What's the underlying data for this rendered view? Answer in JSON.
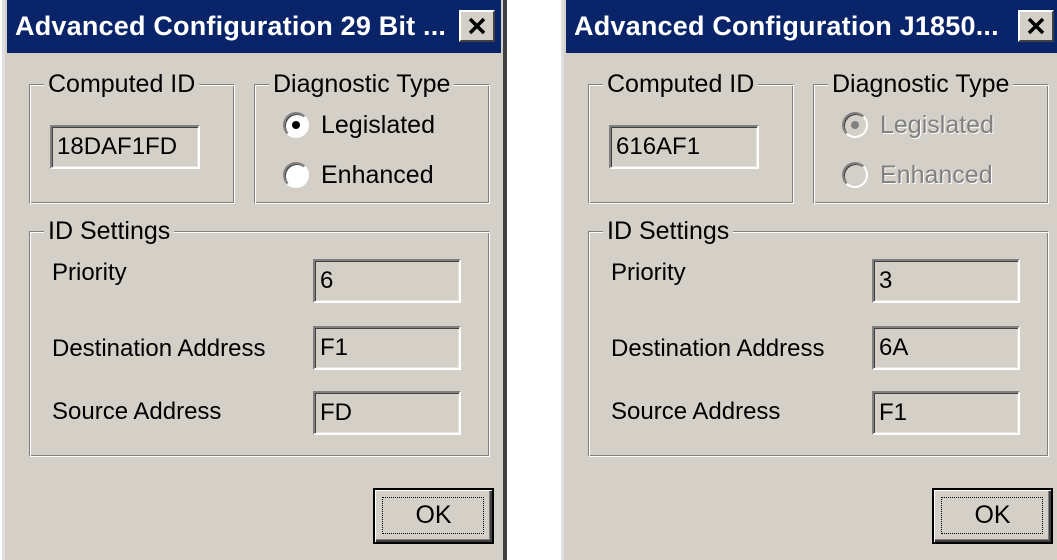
{
  "dialogs": [
    {
      "title": "Advanced Configuration 29 Bit ...",
      "computed_id_label": "Computed ID",
      "computed_id": "18DAF1FD",
      "diagnostic_type_label": "Diagnostic Type",
      "diagnostic_options": [
        {
          "label": "Legislated",
          "selected": true
        },
        {
          "label": "Enhanced",
          "selected": false
        }
      ],
      "diagnostic_enabled": true,
      "id_settings_label": "ID Settings",
      "priority_label": "Priority",
      "priority": "6",
      "destination_label": "Destination Address",
      "destination": "F1",
      "source_label": "Source Address",
      "source": "FD",
      "ok_label": "OK"
    },
    {
      "title": "Advanced Configuration J1850...",
      "computed_id_label": "Computed ID",
      "computed_id": "616AF1",
      "diagnostic_type_label": "Diagnostic Type",
      "diagnostic_options": [
        {
          "label": "Legislated",
          "selected": true
        },
        {
          "label": "Enhanced",
          "selected": false
        }
      ],
      "diagnostic_enabled": false,
      "id_settings_label": "ID Settings",
      "priority_label": "Priority",
      "priority": "3",
      "destination_label": "Destination Address",
      "destination": "6A",
      "source_label": "Source Address",
      "source": "F1",
      "ok_label": "OK"
    }
  ],
  "icons": {
    "close": "close-x-icon",
    "radio": "radio-button-icon"
  },
  "colors": {
    "titlebar": "#0a246a",
    "face": "#d4d0c8",
    "disabled_text": "#808080"
  }
}
